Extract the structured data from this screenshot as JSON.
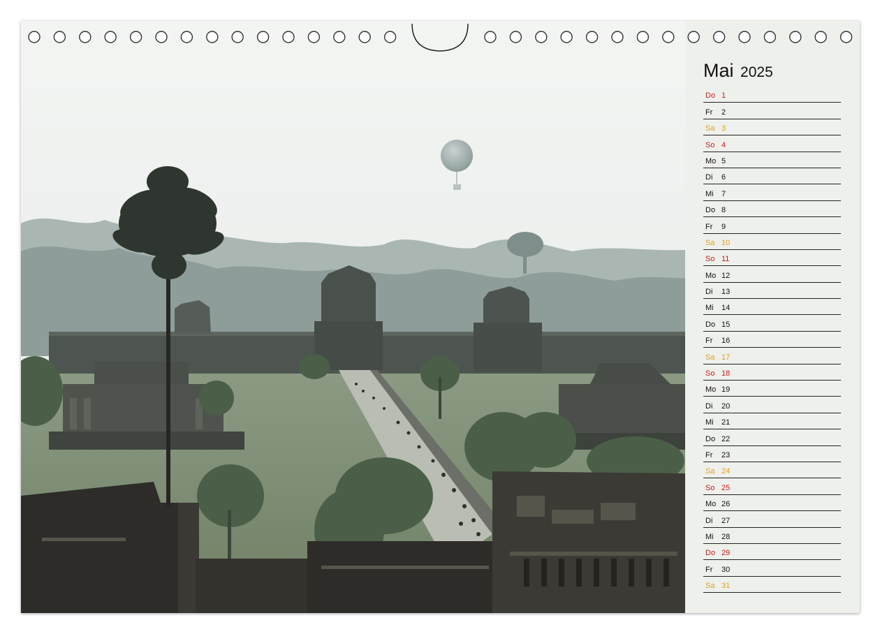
{
  "calendar": {
    "month": "Mai",
    "year": "2025",
    "days": [
      {
        "wd": "Do",
        "d": "1",
        "type": "holiday"
      },
      {
        "wd": "Fr",
        "d": "2",
        "type": "weekday"
      },
      {
        "wd": "Sa",
        "d": "3",
        "type": "saturday"
      },
      {
        "wd": "So",
        "d": "4",
        "type": "sunday"
      },
      {
        "wd": "Mo",
        "d": "5",
        "type": "weekday"
      },
      {
        "wd": "Di",
        "d": "6",
        "type": "weekday"
      },
      {
        "wd": "Mi",
        "d": "7",
        "type": "weekday"
      },
      {
        "wd": "Do",
        "d": "8",
        "type": "weekday"
      },
      {
        "wd": "Fr",
        "d": "9",
        "type": "weekday"
      },
      {
        "wd": "Sa",
        "d": "10",
        "type": "saturday"
      },
      {
        "wd": "So",
        "d": "11",
        "type": "sunday"
      },
      {
        "wd": "Mo",
        "d": "12",
        "type": "weekday"
      },
      {
        "wd": "Di",
        "d": "13",
        "type": "weekday"
      },
      {
        "wd": "Mi",
        "d": "14",
        "type": "weekday"
      },
      {
        "wd": "Do",
        "d": "15",
        "type": "weekday"
      },
      {
        "wd": "Fr",
        "d": "16",
        "type": "weekday"
      },
      {
        "wd": "Sa",
        "d": "17",
        "type": "saturday"
      },
      {
        "wd": "So",
        "d": "18",
        "type": "sunday"
      },
      {
        "wd": "Mo",
        "d": "19",
        "type": "weekday"
      },
      {
        "wd": "Di",
        "d": "20",
        "type": "weekday"
      },
      {
        "wd": "Mi",
        "d": "21",
        "type": "weekday"
      },
      {
        "wd": "Do",
        "d": "22",
        "type": "weekday"
      },
      {
        "wd": "Fr",
        "d": "23",
        "type": "weekday"
      },
      {
        "wd": "Sa",
        "d": "24",
        "type": "saturday"
      },
      {
        "wd": "So",
        "d": "25",
        "type": "sunday"
      },
      {
        "wd": "Mo",
        "d": "26",
        "type": "weekday"
      },
      {
        "wd": "Di",
        "d": "27",
        "type": "weekday"
      },
      {
        "wd": "Mi",
        "d": "28",
        "type": "weekday"
      },
      {
        "wd": "Do",
        "d": "29",
        "type": "holiday"
      },
      {
        "wd": "Fr",
        "d": "30",
        "type": "weekday"
      },
      {
        "wd": "Sa",
        "d": "31",
        "type": "saturday"
      }
    ]
  },
  "colors": {
    "sidebar_bg": "#eef0ec",
    "weekday": "#111111",
    "saturday": "#e0a020",
    "sunday_holiday": "#c8201e"
  },
  "photo": {
    "subject": "temple-landscape-with-balloon"
  }
}
